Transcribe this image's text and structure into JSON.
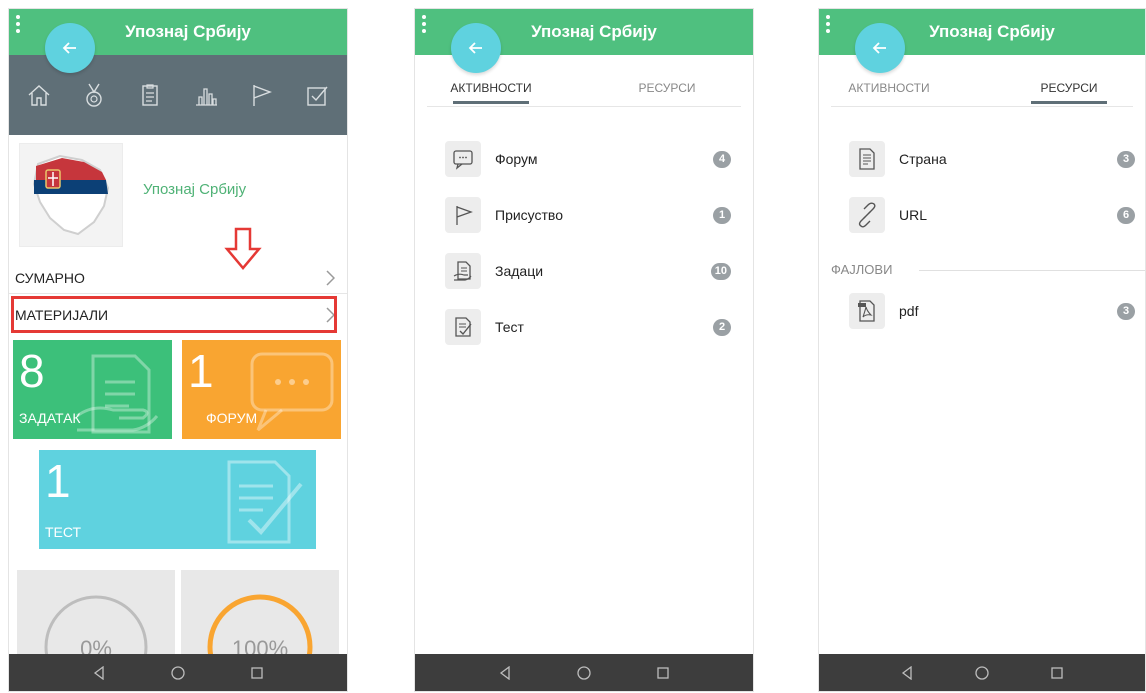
{
  "app_title": "Упознај Србију",
  "screen1": {
    "course_name": "Упознај Србију",
    "rows": [
      "СУМАРНО",
      "МАТЕРИЈАЛИ"
    ],
    "tiles": [
      {
        "number": "8",
        "label": "ЗАДАТАК",
        "color": "#3cc07a"
      },
      {
        "number": "1",
        "label": "ФОРУМ",
        "color": "#f9a531"
      },
      {
        "number": "1",
        "label": "ТЕСТ",
        "color": "#5fd2df"
      }
    ],
    "stats": [
      {
        "value": "0%",
        "progress": 0
      },
      {
        "value": "100%",
        "progress": 100
      }
    ],
    "icons": [
      "home-icon",
      "medal-icon",
      "clipboard-icon",
      "bar-chart-icon",
      "flag-icon",
      "checkbox-icon"
    ]
  },
  "screen2": {
    "tabs": [
      "АКТИВНОСТИ",
      "РЕСУРСИ"
    ],
    "active_tab": 0,
    "items": [
      {
        "label": "Форум",
        "count": "4",
        "icon": "chat-icon"
      },
      {
        "label": "Присуство",
        "count": "1",
        "icon": "flag-icon"
      },
      {
        "label": "Задаци",
        "count": "10",
        "icon": "assignment-icon"
      },
      {
        "label": "Тест",
        "count": "2",
        "icon": "quiz-icon"
      }
    ]
  },
  "screen3": {
    "tabs": [
      "АКТИВНОСТИ",
      "РЕСУРСИ"
    ],
    "active_tab": 1,
    "items": [
      {
        "label": "Страна",
        "count": "3",
        "icon": "page-icon"
      },
      {
        "label": "URL",
        "count": "6",
        "icon": "link-icon"
      }
    ],
    "section_title": "ФАЈЛОВИ",
    "files": [
      {
        "label": "pdf",
        "count": "3",
        "icon": "pdf-icon"
      }
    ]
  },
  "colors": {
    "topbar": "#4fc07f",
    "back_button": "#5fd2df",
    "iconbar": "#5f6f77",
    "highlight": "#e53935",
    "navbar": "#3d3d3d"
  }
}
